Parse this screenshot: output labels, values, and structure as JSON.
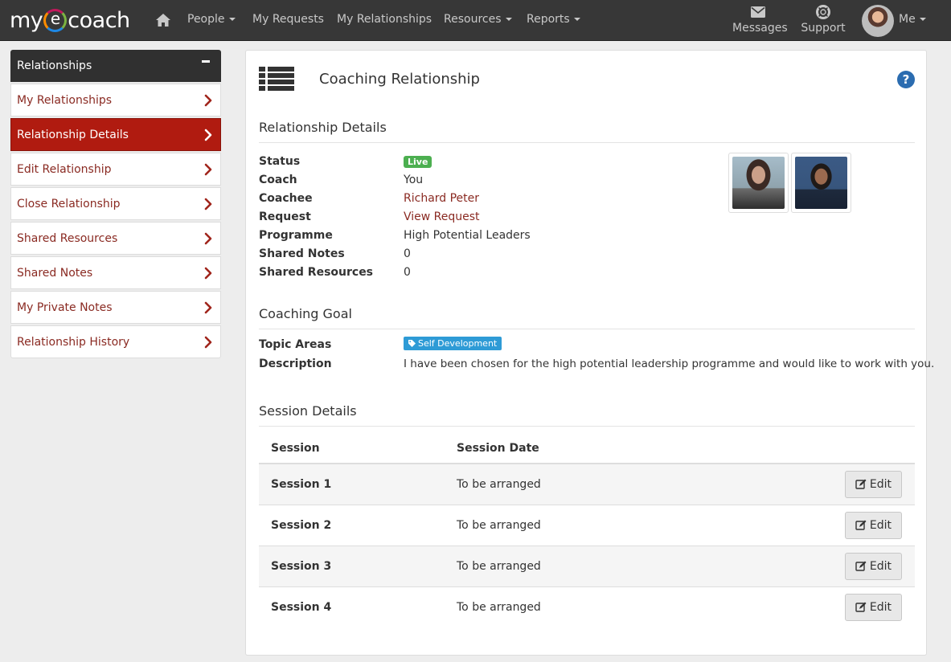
{
  "brand": {
    "logo_pre": "my",
    "logo_mid": "e",
    "logo_post": "coach"
  },
  "nav": {
    "home_icon": "home-icon",
    "people": "People",
    "my_requests": "My Requests",
    "my_relationships": "My Relationships",
    "resources": "Resources",
    "reports": "Reports",
    "messages": "Messages",
    "support": "Support",
    "me": "Me"
  },
  "sidebar": {
    "title": "Relationships",
    "items": [
      {
        "label": "My Relationships",
        "active": false
      },
      {
        "label": "Relationship Details",
        "active": true
      },
      {
        "label": "Edit Relationship",
        "active": false
      },
      {
        "label": "Close Relationship",
        "active": false
      },
      {
        "label": "Shared Resources",
        "active": false
      },
      {
        "label": "Shared Notes",
        "active": false
      },
      {
        "label": "My Private Notes",
        "active": false
      },
      {
        "label": "Relationship History",
        "active": false
      }
    ]
  },
  "main": {
    "title": "Coaching Relationship",
    "help": "?",
    "details": {
      "title": "Relationship Details",
      "status_label": "Status",
      "status_value": "Live",
      "coach_label": "Coach",
      "coach_value": "You",
      "coachee_label": "Coachee",
      "coachee_value": "Richard Peter",
      "request_label": "Request",
      "request_value": "View Request",
      "programme_label": "Programme",
      "programme_value": "High Potential Leaders",
      "notes_label": "Shared Notes",
      "notes_value": "0",
      "resources_label": "Shared Resources",
      "resources_value": "0"
    },
    "goal": {
      "title": "Coaching Goal",
      "topic_label": "Topic Areas",
      "topic_value": "Self Development",
      "desc_label": "Description",
      "desc_value": "I have been chosen for the high potential leadership programme and would like to work with you."
    },
    "sessions": {
      "title": "Session Details",
      "col_session": "Session",
      "col_date": "Session Date",
      "edit_label": "Edit",
      "rows": [
        {
          "session": "Session 1",
          "date": "To be arranged"
        },
        {
          "session": "Session 2",
          "date": "To be arranged"
        },
        {
          "session": "Session 3",
          "date": "To be arranged"
        },
        {
          "session": "Session 4",
          "date": "To be arranged"
        }
      ]
    }
  },
  "colors": {
    "navbar": "#373737",
    "accent": "#b01b10",
    "link": "#8a2a22",
    "live": "#4caf50",
    "tag": "#2e9bd6"
  }
}
